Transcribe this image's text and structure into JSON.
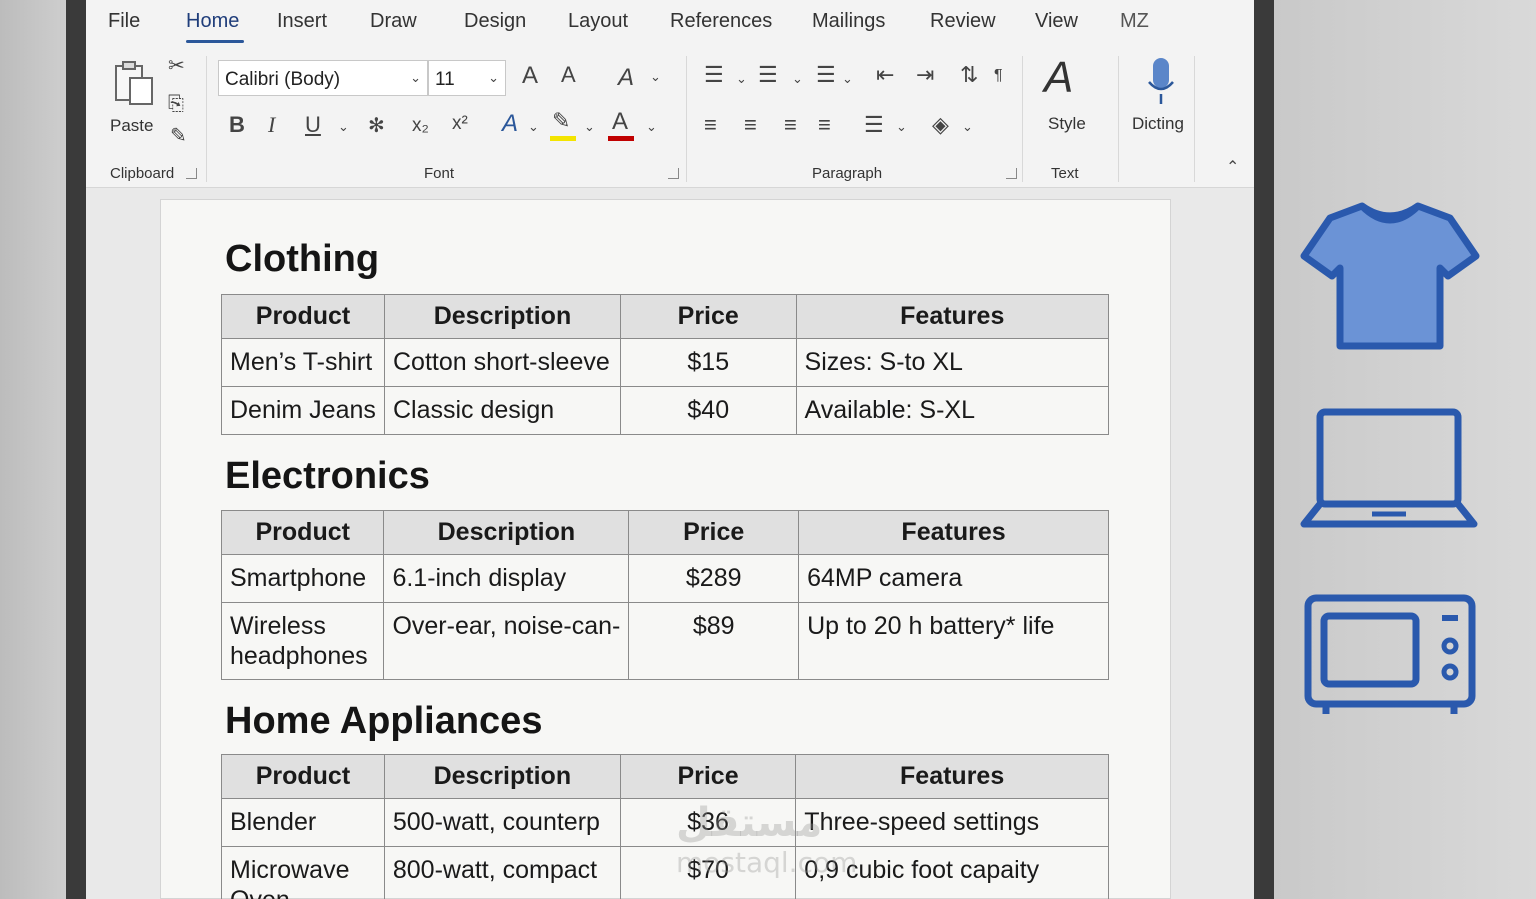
{
  "tabs": [
    {
      "label": "File",
      "active": false
    },
    {
      "label": "Home",
      "active": true
    },
    {
      "label": "Insert",
      "active": false
    },
    {
      "label": "Draw",
      "active": false
    },
    {
      "label": "Design",
      "active": false
    },
    {
      "label": "Layout",
      "active": false
    },
    {
      "label": "References",
      "active": false
    },
    {
      "label": "Mailings",
      "active": false
    },
    {
      "label": "Review",
      "active": false
    },
    {
      "label": "View",
      "active": false
    }
  ],
  "tab_extra_glyph": "MZ",
  "ribbon": {
    "paste_label": "Paste",
    "clipboard_label": "Clipboard",
    "font_name": "Calibri (Body)",
    "font_size": "11",
    "font_label": "Font",
    "paragraph_label": "Paragraph",
    "style_label": "Style",
    "text_label": "Text",
    "dictate_label": "Dicting",
    "grow_font": "A",
    "shrink_font": "A",
    "bold": "B",
    "italic": "I",
    "underline": "U",
    "subscript": "x₂",
    "superscript": "x²"
  },
  "accent_color": "#2b579a",
  "highlight_color": "#f3e400",
  "font_color": "#c00000",
  "icon_color": "#2f5fb0",
  "sections": [
    {
      "title": "Clothing",
      "headers": [
        "Product",
        "Description",
        "Price",
        "Features"
      ],
      "rows": [
        [
          "Men’s T-shirt",
          "Cotton short-sleeve",
          "$15",
          "Sizes: S-to XL"
        ],
        [
          "Denim Jeans",
          "Classic design",
          "$40",
          "Available: S-XL"
        ]
      ]
    },
    {
      "title": "Electronics",
      "headers": [
        "Product",
        "Description",
        "Price",
        "Features"
      ],
      "rows": [
        [
          "Smartphone",
          "6.1-inch display",
          "$289",
          "64MP camera"
        ],
        [
          "Wireless headphones",
          "Over-ear, noise-can-",
          "$89",
          "Up to 20 h battery* life"
        ]
      ]
    },
    {
      "title": "Home Appliances",
      "headers": [
        "Product",
        "Description",
        "Price",
        "Features"
      ],
      "rows": [
        [
          "Blender",
          "500-watt, counterp",
          "$36",
          "Three-speed settings"
        ],
        [
          "Microwave Oven",
          "800-watt, compact",
          "$70",
          "0,9 cubic foot capaity"
        ]
      ]
    }
  ],
  "watermark": {
    "main": "مستقل",
    "sub": "mostaql.com"
  },
  "side_icons": [
    "t-shirt-icon",
    "laptop-icon",
    "microwave-icon"
  ]
}
